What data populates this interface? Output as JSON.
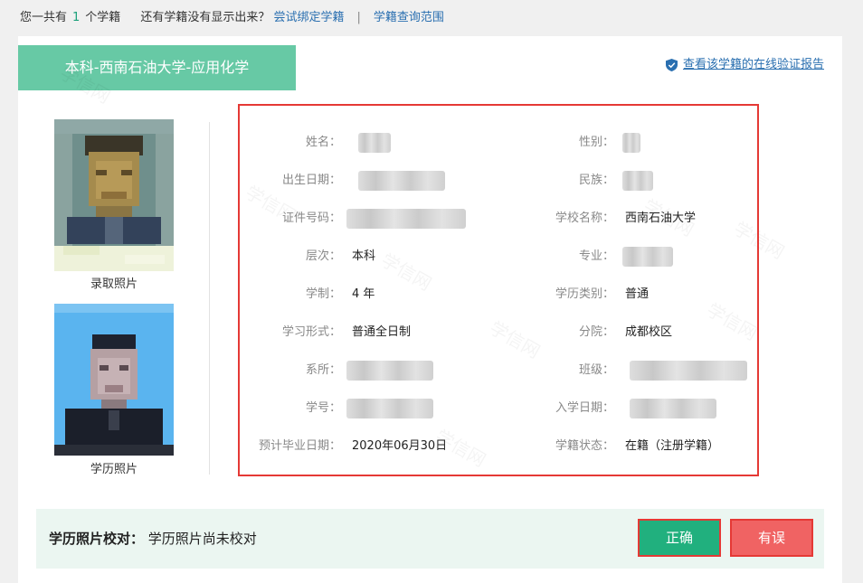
{
  "top_bar": {
    "count_prefix": "您一共有",
    "count": "1",
    "count_suffix": "个学籍",
    "missing_question": "还有学籍没有显示出来？",
    "bind_link": "尝试绑定学籍",
    "separator": "|",
    "scope_link": "学籍查询范围"
  },
  "record": {
    "degree_tab": "本科-西南石油大学-应用化学",
    "verify_link": "查看该学籍的在线验证报告",
    "verify_icon": "shield-check-icon",
    "photo1_caption": "录取照片",
    "photo2_caption": "学历照片",
    "watermark": "学信网"
  },
  "fields": {
    "name": {
      "label": "姓名：",
      "value": ""
    },
    "gender": {
      "label": "性别：",
      "value": ""
    },
    "birth": {
      "label": "出生日期：",
      "value": ""
    },
    "ethnicity": {
      "label": "民族：",
      "value": ""
    },
    "id_number": {
      "label": "证件号码：",
      "value": ""
    },
    "school": {
      "label": "学校名称：",
      "value": "西南石油大学"
    },
    "level": {
      "label": "层次：",
      "value": "本科"
    },
    "major": {
      "label": "专业：",
      "value": ""
    },
    "duration": {
      "label": "学制：",
      "value": "4 年"
    },
    "edu_type": {
      "label": "学历类别：",
      "value": "普通"
    },
    "study_form": {
      "label": "学习形式：",
      "value": "普通全日制"
    },
    "branch": {
      "label": "分院：",
      "value": "成都校区"
    },
    "department": {
      "label": "系所：",
      "value": ""
    },
    "class": {
      "label": "班级：",
      "value": ""
    },
    "student_no": {
      "label": "学号：",
      "value": ""
    },
    "enroll_date": {
      "label": "入学日期：",
      "value": ""
    },
    "grad_date": {
      "label": "预计毕业日期：",
      "value": "2020年06月30日"
    },
    "status": {
      "label": "学籍状态：",
      "value": "在籍（注册学籍）"
    }
  },
  "photo_check": {
    "title": "学历照片校对：",
    "status": "学历照片尚未校对",
    "correct_button": "正确",
    "wrong_button": "有误"
  },
  "colors": {
    "accent_green": "#67c9a5",
    "correct_button": "#21b07e",
    "wrong_button": "#f06363",
    "highlight_border": "#e53935",
    "link": "#2a6fb0"
  }
}
